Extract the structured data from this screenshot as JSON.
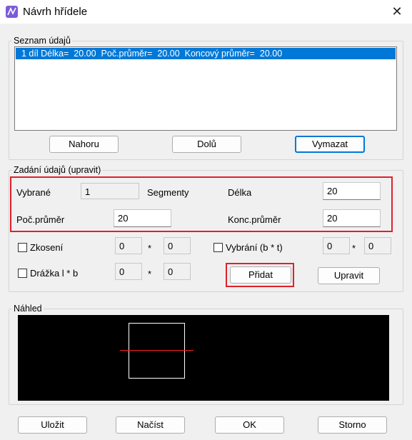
{
  "window": {
    "title": "Návrh hřídele",
    "close_glyph": "✕"
  },
  "list_group": {
    "label": "Seznam údajů",
    "items": [
      "1 díl Délka=  20.00  Poč.průměr=  20.00  Koncový průměr=  20.00"
    ],
    "buttons": {
      "up": "Nahoru",
      "down": "Dolů",
      "delete": "Vymazat"
    }
  },
  "input_group": {
    "label": "Zadání údajů (upravit)",
    "selected_label": "Vybrané",
    "selected_value": "1",
    "segments_label": "Segmenty",
    "length_label": "Délka",
    "length_value": "20",
    "start_diameter_label": "Poč.průměr",
    "start_diameter_value": "20",
    "end_diameter_label": "Konc.průměr",
    "end_diameter_value": "20",
    "chamfer_label": "Zkosení",
    "chamfer_a": "0",
    "chamfer_b": "0",
    "undercut_label": "Vybrání (b * t)",
    "undercut_a": "0",
    "undercut_b": "0",
    "groove_label": "Drážka l * b",
    "groove_a": "0",
    "groove_b": "0",
    "times_symbol": "*",
    "add_button": "Přidat",
    "edit_button": "Upravit"
  },
  "preview_group": {
    "label": "Náhled"
  },
  "footer": {
    "save": "Uložit",
    "load": "Načíst",
    "ok": "OK",
    "cancel": "Storno"
  },
  "colors": {
    "accent": "#0078d7",
    "highlight": "#e0202a",
    "preview_bg": "#000000",
    "preview_shape": "#ffffff",
    "preview_axis": "#ff2020"
  },
  "icons": {
    "app": "shaft-design-icon",
    "close": "close-icon"
  }
}
